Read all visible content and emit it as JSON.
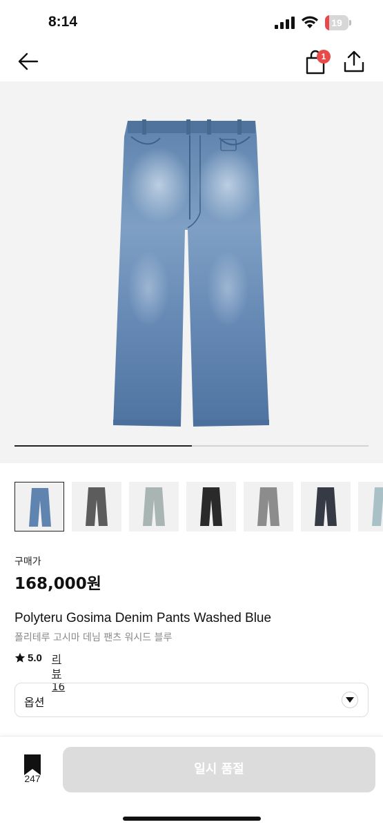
{
  "status_bar": {
    "time": "8:14",
    "battery": "19",
    "battery_level": 0.19
  },
  "nav": {
    "cart_count": "1",
    "icons": [
      "back-arrow-icon",
      "shopping-bag-icon",
      "share-icon"
    ]
  },
  "gallery": {
    "progress": 0.5,
    "selected_index": 0,
    "thumbnail_count": 7
  },
  "product": {
    "price_label": "구매가",
    "price": "168,000원",
    "name_en": "Polyteru Gosima Denim Pants Washed Blue",
    "name_ko": "폴리테루 고시마 데님 팬츠 워시드 블루",
    "rating": "5.0",
    "review_link": "리뷰 16"
  },
  "option": {
    "label": "옵션"
  },
  "bottom_bar": {
    "bookmark_count": "247",
    "cta_label": "일시 품절"
  },
  "colors": {
    "accent_red": "#e84a4a",
    "cta_disabled": "#dcdcdc",
    "denim": "#5f84b0"
  }
}
